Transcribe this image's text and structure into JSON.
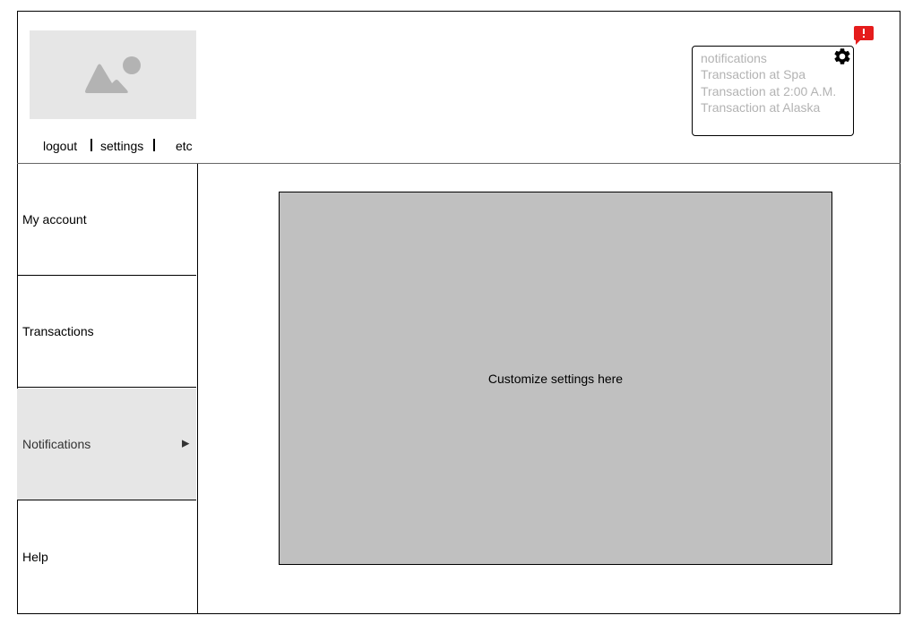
{
  "header": {
    "links": {
      "logout": "logout",
      "settings": "settings",
      "etc": "etc"
    }
  },
  "notifications_panel": {
    "title": "notifications",
    "items": [
      "Transaction at Spa",
      "Transaction at 2:00 A.M.",
      "Transaction at Alaska"
    ],
    "settings_icon": "gear-icon",
    "alert_icon": "alert-icon",
    "alert_color": "#e51c1c"
  },
  "sidebar": {
    "items": [
      {
        "label": "My account"
      },
      {
        "label": "Transactions"
      },
      {
        "label": "Notifications",
        "active": true,
        "icon": "triangle-right-icon"
      },
      {
        "label": "Help"
      }
    ],
    "active_color": "#e6e6e6"
  },
  "main": {
    "content_label": "Customize settings here",
    "content_bg": "#c0c0c0"
  }
}
